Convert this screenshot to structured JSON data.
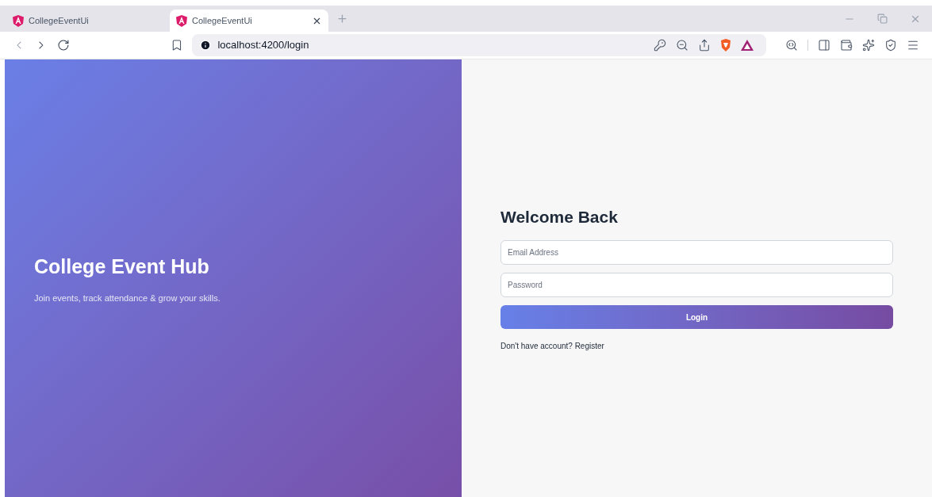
{
  "browser": {
    "tabs": [
      {
        "title": "CollegeEventUi",
        "selected": false
      },
      {
        "title": "CollegeEventUi",
        "selected": true
      }
    ],
    "url": "localhost:4200/login"
  },
  "hero": {
    "title": "College Event Hub",
    "subtitle": "Join events, track attendance & grow your skills."
  },
  "login": {
    "title": "Welcome Back",
    "fields": [
      {
        "placeholder": "Email Address"
      },
      {
        "placeholder": "Password"
      }
    ],
    "button": "Login",
    "register_prompt": "Don't have account? Register"
  }
}
